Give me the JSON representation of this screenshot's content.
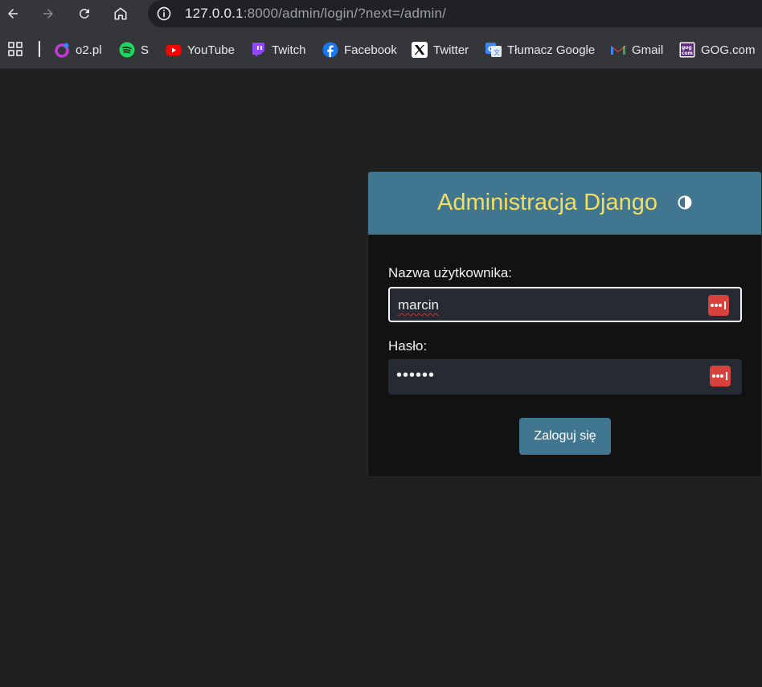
{
  "toolbar": {
    "url_host": "127.0.0.1",
    "url_rest": ":8000/admin/login/?next=/admin/",
    "icons": [
      "back-icon",
      "forward-icon",
      "reload-icon",
      "home-icon",
      "info-icon"
    ]
  },
  "bookmarks": [
    {
      "label": "o2.pl",
      "icon": "o2-icon"
    },
    {
      "label": "S",
      "icon": "spotify-icon"
    },
    {
      "label": "YouTube",
      "icon": "youtube-icon"
    },
    {
      "label": "Twitch",
      "icon": "twitch-icon"
    },
    {
      "label": "Facebook",
      "icon": "facebook-icon"
    },
    {
      "label": "Twitter",
      "icon": "twitter-x-icon"
    },
    {
      "label": "Tłumacz Google",
      "icon": "google-translate-icon"
    },
    {
      "label": "Gmail",
      "icon": "gmail-icon"
    },
    {
      "label": "GOG.com",
      "icon": "gog-icon"
    }
  ],
  "login": {
    "title": "Administracja Django",
    "username_label": "Nazwa użytkownika:",
    "username_value": "marcin",
    "password_label": "Hasło:",
    "password_value": "••••••",
    "submit_label": "Zaloguj się"
  },
  "colors": {
    "header_bg": "#417690",
    "title": "#f5dd5d",
    "page_bg": "#202020",
    "card_bg": "#121212",
    "input_bg": "#262a33",
    "lastpass": "#d9413d"
  }
}
